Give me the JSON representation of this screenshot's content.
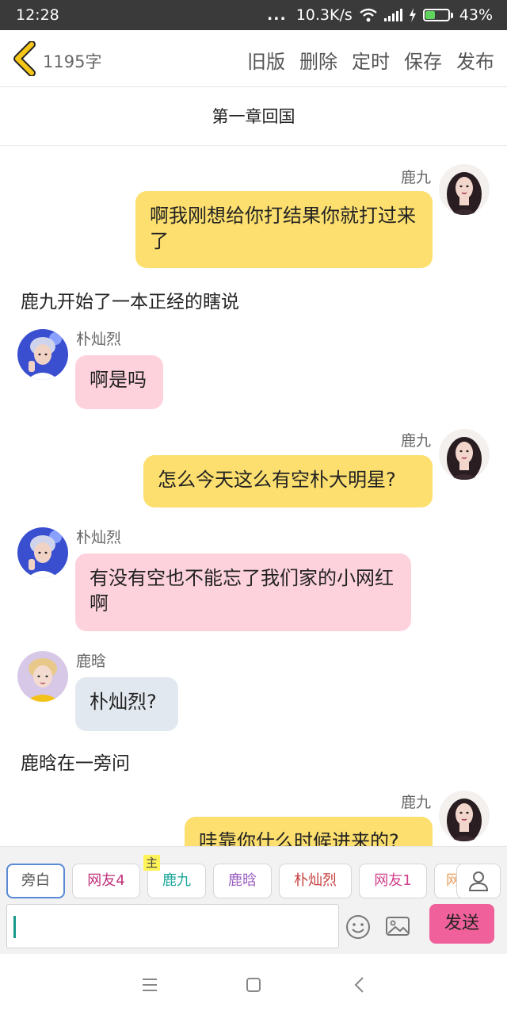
{
  "status_bar": {
    "time": "12:28",
    "dots": "...",
    "network_speed": "10.3K/s",
    "battery_percent": "43%",
    "battery_level": 0.43
  },
  "header": {
    "word_count": "1195字",
    "actions": [
      "旧版",
      "删除",
      "定时",
      "保存",
      "发布"
    ]
  },
  "chapter_title": "第一章回国",
  "messages": {
    "m1": {
      "name": "鹿九",
      "text": "啊我刚想给你打结果你就打过来了"
    },
    "n1": "鹿九开始了一本正经的瞎说",
    "m2": {
      "name": "朴灿烈",
      "text": "啊是吗"
    },
    "m3": {
      "name": "鹿九",
      "text": "怎么今天这么有空朴大明星?"
    },
    "m4": {
      "name": "朴灿烈",
      "text": "有没有空也不能忘了我们家的小网红啊"
    },
    "m5": {
      "name": "鹿晗",
      "text": "朴灿烈?"
    },
    "n2": "鹿晗在一旁问",
    "m6": {
      "name": "鹿九",
      "text": "哇靠你什么时候进来的?"
    }
  },
  "roles": {
    "host_badge": "主",
    "chips": [
      {
        "label": "旁白",
        "color": "#555555"
      },
      {
        "label": "网友4",
        "color": "#c0307a"
      },
      {
        "label": "鹿九",
        "color": "#1aa59a"
      },
      {
        "label": "鹿晗",
        "color": "#9a5fc0"
      },
      {
        "label": "朴灿烈",
        "color": "#c84040"
      },
      {
        "label": "网友1",
        "color": "#d0408a"
      },
      {
        "label": "网",
        "color": "#e8a060"
      }
    ]
  },
  "input": {
    "value": ""
  },
  "send_label": "发送",
  "colors": {
    "narrator_bubble": "#fcdf6f",
    "park_bubble": "#fdd2dd",
    "luhan_bubble": "#e2e8ef",
    "send": "#f0609a",
    "back_arrow": "#f5c518"
  }
}
